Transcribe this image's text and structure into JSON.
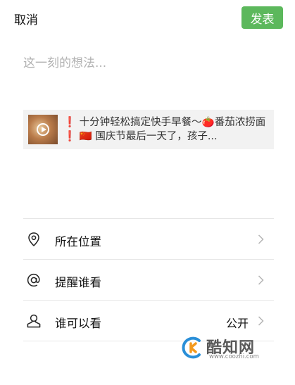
{
  "header": {
    "cancel_label": "取消",
    "publish_label": "发表",
    "publish_color": "#5cb85c"
  },
  "composer": {
    "placeholder": "这一刻的想法..."
  },
  "share_card": {
    "text": "❗ 十分钟轻松搞定快手早餐～🍅番茄浓捞面❗ 🇨🇳 国庆节最后一天了，孩子...",
    "thumbnail_icon": "play-icon"
  },
  "menu": {
    "items": [
      {
        "icon": "location-pin-icon",
        "label": "所在位置",
        "value": ""
      },
      {
        "icon": "at-icon",
        "label": "提醒谁看",
        "value": ""
      },
      {
        "icon": "person-icon",
        "label": "谁可以看",
        "value": "公开"
      }
    ]
  },
  "watermark": {
    "name": "酷知网",
    "url": "www.coozhi.com"
  }
}
